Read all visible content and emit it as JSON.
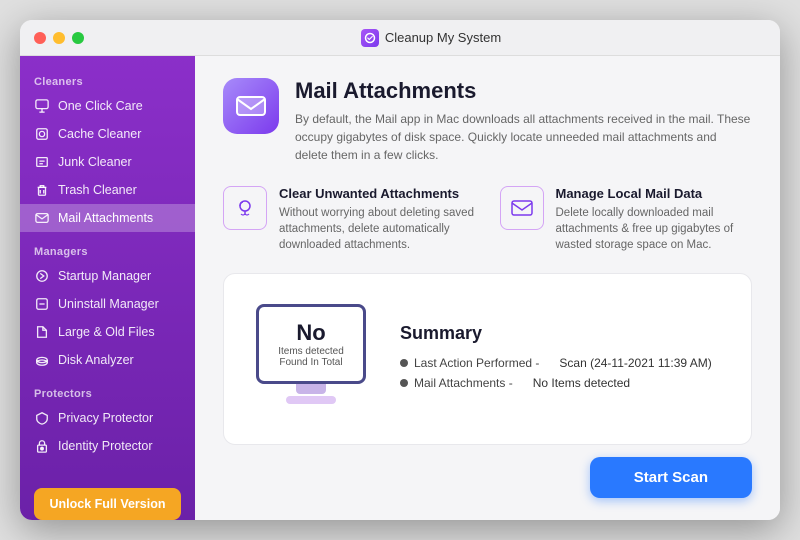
{
  "window": {
    "title": "Cleanup My System"
  },
  "sidebar": {
    "cleaners_label": "Cleaners",
    "managers_label": "Managers",
    "protectors_label": "Protectors",
    "items": {
      "cleaners": [
        {
          "id": "one-click-care",
          "label": "One Click Care",
          "icon": "🖱"
        },
        {
          "id": "cache-cleaner",
          "label": "Cache Cleaner",
          "icon": "⚙"
        },
        {
          "id": "junk-cleaner",
          "label": "Junk Cleaner",
          "icon": "🗂"
        },
        {
          "id": "trash-cleaner",
          "label": "Trash Cleaner",
          "icon": "🗑"
        },
        {
          "id": "mail-attachments",
          "label": "Mail Attachments",
          "icon": "✉",
          "active": true
        }
      ],
      "managers": [
        {
          "id": "startup-manager",
          "label": "Startup Manager",
          "icon": "⚡"
        },
        {
          "id": "uninstall-manager",
          "label": "Uninstall Manager",
          "icon": "📦"
        },
        {
          "id": "large-old-files",
          "label": "Large & Old Files",
          "icon": "📁"
        },
        {
          "id": "disk-analyzer",
          "label": "Disk Analyzer",
          "icon": "💾"
        }
      ],
      "protectors": [
        {
          "id": "privacy-protector",
          "label": "Privacy Protector",
          "icon": "🛡"
        },
        {
          "id": "identity-protector",
          "label": "Identity Protector",
          "icon": "🔒"
        }
      ]
    },
    "unlock_btn": "Unlock Full Version"
  },
  "page": {
    "title": "Mail Attachments",
    "description": "By default, the Mail app in Mac downloads all attachments received in the mail. These occupy gigabytes of disk space. Quickly locate unneeded mail attachments and delete them in a few clicks.",
    "features": [
      {
        "title": "Clear Unwanted Attachments",
        "description": "Without worrying about deleting saved attachments, delete automatically downloaded attachments.",
        "icon": "⟳"
      },
      {
        "title": "Manage Local Mail Data",
        "description": "Delete locally downloaded mail attachments & free up gigabytes of wasted storage space on Mac.",
        "icon": "✉"
      }
    ],
    "summary": {
      "title": "Summary",
      "monitor_no": "No",
      "monitor_items": "Items detected",
      "monitor_found": "Found In Total",
      "rows": [
        {
          "label": "Last Action Performed -",
          "value": "Scan (24-11-2021 11:39 AM)"
        },
        {
          "label": "Mail Attachments -",
          "value": "No Items detected"
        }
      ]
    },
    "start_scan_btn": "Start Scan"
  }
}
